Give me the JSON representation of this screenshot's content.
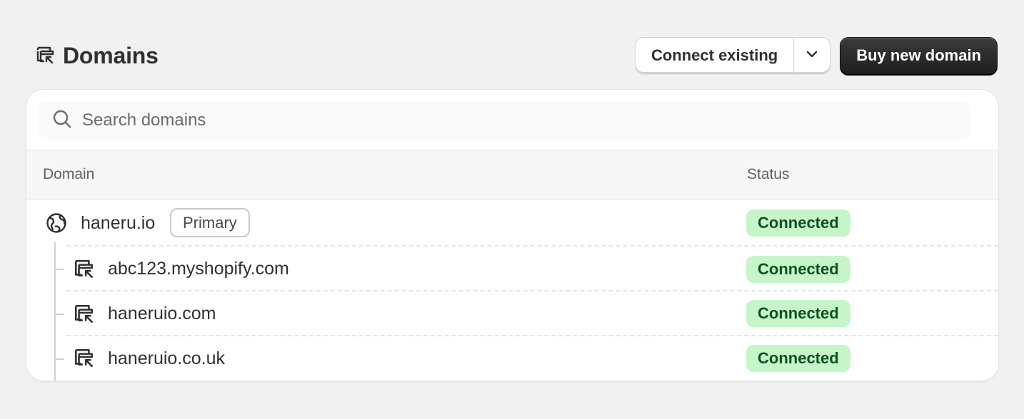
{
  "header": {
    "title": "Domains",
    "title_icon": "domain-icon"
  },
  "actions": {
    "connect_existing_label": "Connect existing",
    "buy_new_label": "Buy new domain"
  },
  "search": {
    "placeholder": "Search domains",
    "value": ""
  },
  "table": {
    "columns": [
      "Domain",
      "Status"
    ],
    "primary": {
      "domain": "haneru.io",
      "badge": "Primary",
      "status": "Connected",
      "icon": "globe-icon"
    },
    "rows": [
      {
        "domain": "abc123.myshopify.com",
        "status": "Connected",
        "icon": "domain-redirect-icon"
      },
      {
        "domain": "haneruio.com",
        "status": "Connected",
        "icon": "domain-redirect-icon"
      },
      {
        "domain": "haneruio.co.uk",
        "status": "Connected",
        "icon": "domain-redirect-icon"
      }
    ]
  },
  "colors": {
    "status_bg": "#c5f5c8",
    "status_text": "#0f4f22",
    "primary_button": "#303030"
  }
}
